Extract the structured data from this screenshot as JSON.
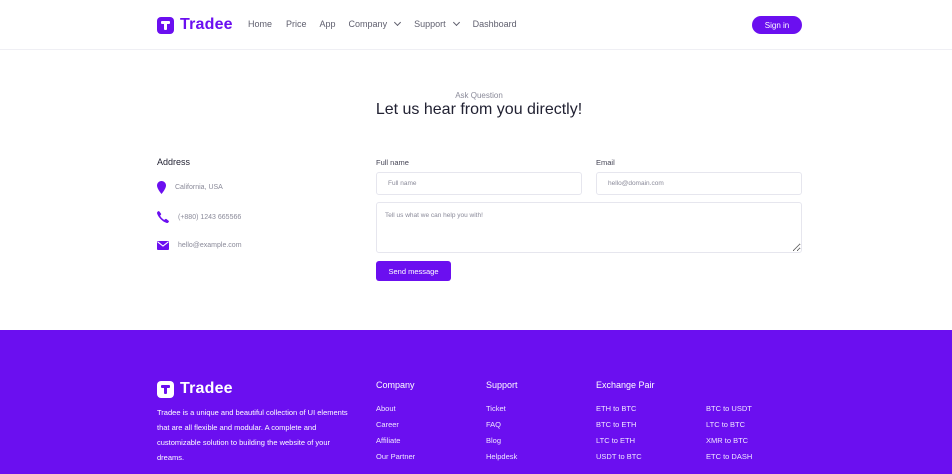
{
  "brand": {
    "name": "Tradee",
    "accent": "#6b0ff0"
  },
  "nav": {
    "items": [
      "Home",
      "Price",
      "App",
      "Company",
      "Support",
      "Dashboard"
    ],
    "signin_label": "Sign in"
  },
  "contact": {
    "eyebrow": "Ask Question",
    "headline": "Let us hear from you directly!",
    "address_title": "Address",
    "address": [
      {
        "icon": "map-pin-icon",
        "text": "California, USA"
      },
      {
        "icon": "phone-icon",
        "text": "(+880) 1243 665566"
      },
      {
        "icon": "envelope-icon",
        "text": "hello@example.com"
      }
    ],
    "form": {
      "fullname_label": "Full name",
      "fullname_placeholder": "Full name",
      "email_label": "Email",
      "email_placeholder": "hello@domain.com",
      "message_placeholder": "Tell us what we can help you with!",
      "send_label": "Send message"
    }
  },
  "footer": {
    "brand": "Tradee",
    "description": "Tradee is a unique and beautiful collection of UI elements that are all flexible and modular. A complete and customizable solution to building the website of your dreams.",
    "company": {
      "title": "Company",
      "links": [
        "About",
        "Career",
        "Affiliate",
        "Our Partner"
      ]
    },
    "support": {
      "title": "Support",
      "links": [
        "Ticket",
        "FAQ",
        "Blog",
        "Helpdesk"
      ]
    },
    "exchange": {
      "title": "Exchange Pair",
      "col1": [
        "ETH to BTC",
        "BTC to ETH",
        "LTC to ETH",
        "USDT to BTC"
      ],
      "col2": [
        "BTC to USDT",
        "LTC to BTC",
        "XMR to BTC",
        "ETC to DASH"
      ]
    }
  }
}
